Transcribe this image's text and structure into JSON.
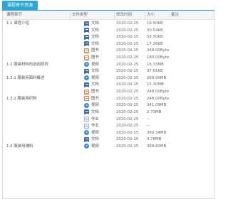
{
  "title": "课程章节资源",
  "headers": {
    "chapter": "课程章节",
    "file_type": "文件类型",
    "date": "修改时间",
    "size": "大小",
    "note": "备注"
  },
  "icons": {
    "文档": "document-icon",
    "图书": "book-icon",
    "视频": "video-icon",
    "作业": "homework-icon"
  },
  "rows": [
    {
      "chapter": "1.1 课程介绍",
      "type": "文档",
      "date": "2020-02-25",
      "size": "16.50KB"
    },
    {
      "chapter": "",
      "type": "文档",
      "date": "2020-02-25",
      "size": "30.54KB"
    },
    {
      "chapter": "",
      "type": "文档",
      "date": "2020-02-25",
      "size": "53.50KB"
    },
    {
      "chapter": "",
      "type": "文档",
      "date": "2020-02-25",
      "size": "17.26KB"
    },
    {
      "chapter": "",
      "type": "图书",
      "date": "2020-02-25",
      "size": "248.00Byte"
    },
    {
      "chapter": "",
      "type": "图书",
      "date": "2020-02-25",
      "size": "180.00Byte"
    },
    {
      "chapter": "1.2 服装材料的选用原则",
      "type": "视频",
      "date": "2020-02-25",
      "size": "16.33MB"
    },
    {
      "chapter": "",
      "type": "文档",
      "date": "2020-02-25",
      "size": "37.61KB"
    },
    {
      "chapter": "1.3.1 服装用面料概述",
      "type": "视频",
      "date": "2020-02-25",
      "size": "269.90MB"
    },
    {
      "chapter": "",
      "type": "文档",
      "date": "2020-02-25",
      "size": "15.30MB"
    },
    {
      "chapter": "",
      "type": "图书",
      "date": "2020-02-25",
      "size": "248.00Byte"
    },
    {
      "chapter": "1.3.2 服装用织物",
      "type": "图书",
      "date": "2020-02-25",
      "size": "248.00Byte"
    },
    {
      "chapter": "",
      "type": "视频",
      "date": "2020-02-25",
      "size": "341.09MB"
    },
    {
      "chapter": "",
      "type": "文档",
      "date": "2020-02-25",
      "size": "2.73MB"
    },
    {
      "chapter": "",
      "type": "作业",
      "date": "2020-02-25",
      "size": "--"
    },
    {
      "chapter": "",
      "type": "作业",
      "date": "2020-02-25",
      "size": "--"
    },
    {
      "chapter": "",
      "type": "视频",
      "date": "2020-02-25",
      "size": "360.34MB"
    },
    {
      "chapter": "",
      "type": "文档",
      "date": "2020-02-25",
      "size": "4.78MB"
    },
    {
      "chapter": "1.4 服装用辅料",
      "type": "视频",
      "date": "2020-02-25",
      "size": "369.82MB"
    }
  ]
}
